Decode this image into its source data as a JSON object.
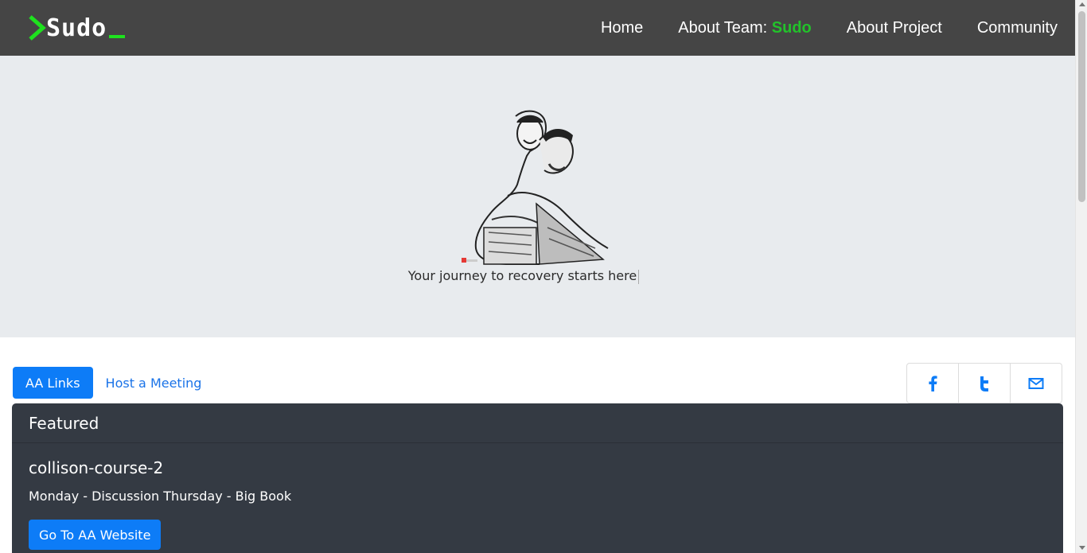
{
  "brand": {
    "name": "Sudo",
    "accent_color": "#1ee21e"
  },
  "nav": {
    "home": "Home",
    "about_team_prefix": "About Team: ",
    "about_team_accent": "Sudo",
    "about_project": "About Project",
    "community": "Community"
  },
  "hero": {
    "image_icon": "recovery-illustration",
    "tagline": "Your journey to recovery starts here"
  },
  "tabs": {
    "aa_links": "AA Links",
    "host_meeting": "Host a Meeting"
  },
  "social": {
    "facebook": "facebook-icon",
    "twitter": "twitter-icon",
    "email": "mail-icon"
  },
  "featured": {
    "header": "Featured",
    "title": "collison-course-2",
    "schedule": "Monday - Discussion Thursday - Big Book",
    "button": "Go To AA Website"
  },
  "colors": {
    "navbar": "#454545",
    "primary": "#0d7cf7",
    "card": "#343a43",
    "hero_bg": "#e8ebee"
  }
}
